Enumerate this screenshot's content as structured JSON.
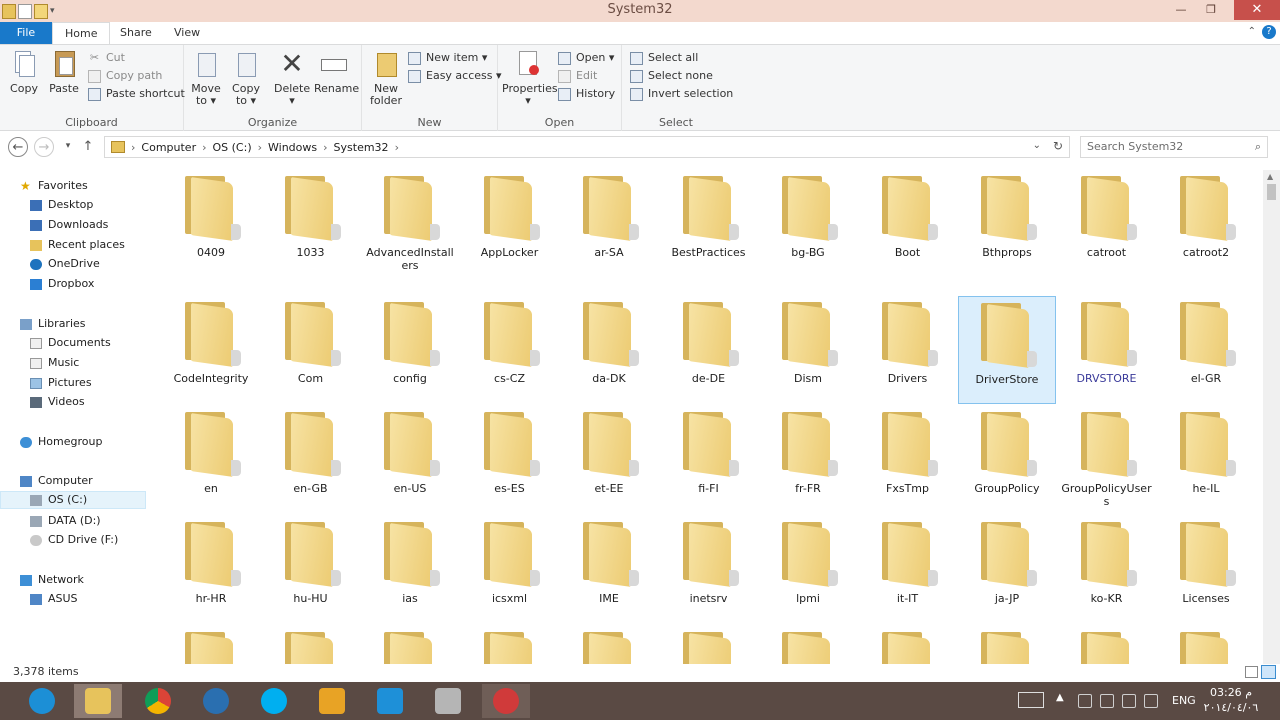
{
  "window": {
    "title": "System32"
  },
  "ribbon_tabs": [
    "File",
    "Home",
    "Share",
    "View"
  ],
  "ribbon": {
    "clipboard": {
      "label": "Clipboard",
      "copy": "Copy",
      "paste": "Paste",
      "cut": "Cut",
      "copy_path": "Copy path",
      "paste_shortcut": "Paste shortcut"
    },
    "organize": {
      "label": "Organize",
      "move_to": "Move",
      "move_to2": "to ▾",
      "copy_to": "Copy",
      "copy_to2": "to ▾",
      "delete": "Delete",
      "delete2": "▾",
      "rename": "Rename"
    },
    "new": {
      "label": "New",
      "new_folder": "New",
      "new_folder2": "folder",
      "new_item": "New item ▾",
      "easy_access": "Easy access ▾"
    },
    "open": {
      "label": "Open",
      "properties": "Properties",
      "properties2": "▾",
      "open": "Open ▾",
      "edit": "Edit",
      "history": "History"
    },
    "select": {
      "label": "Select",
      "select_all": "Select all",
      "select_none": "Select none",
      "invert": "Invert selection"
    }
  },
  "address": {
    "crumbs": [
      "Computer",
      "OS (C:)",
      "Windows",
      "System32"
    ],
    "search_placeholder": "Search System32"
  },
  "nav": {
    "favorites": {
      "label": "Favorites",
      "items": [
        "Desktop",
        "Downloads",
        "Recent places",
        "OneDrive",
        "Dropbox"
      ]
    },
    "libraries": {
      "label": "Libraries",
      "items": [
        "Documents",
        "Music",
        "Pictures",
        "Videos"
      ]
    },
    "homegroup": "Homegroup",
    "computer": {
      "label": "Computer",
      "items": [
        "OS (C:)",
        "DATA (D:)",
        "CD Drive (F:)"
      ]
    },
    "network": {
      "label": "Network",
      "items": [
        "ASUS"
      ]
    }
  },
  "folders": [
    [
      "0409",
      "1033",
      "AdvancedInstallers",
      "AppLocker",
      "ar-SA",
      "BestPractices",
      "bg-BG",
      "Boot",
      "Bthprops",
      "catroot",
      "catroot2"
    ],
    [
      "CodeIntegrity",
      "Com",
      "config",
      "cs-CZ",
      "da-DK",
      "de-DE",
      "Dism",
      "Drivers",
      "DriverStore",
      "DRVSTORE",
      "el-GR"
    ],
    [
      "en",
      "en-GB",
      "en-US",
      "es-ES",
      "et-EE",
      "fi-FI",
      "fr-FR",
      "FxsTmp",
      "GroupPolicy",
      "GroupPolicyUsers",
      "he-IL"
    ],
    [
      "hr-HR",
      "hu-HU",
      "ias",
      "icsxml",
      "IME",
      "inetsrv",
      "lpmi",
      "it-IT",
      "ja-JP",
      "ko-KR",
      "Licenses"
    ]
  ],
  "status": {
    "count": "3,378 items"
  },
  "taskbar": {
    "lang": "ENG",
    "time": "03:26 م",
    "date": "٢٠١٤/٠٤/٠٦"
  },
  "colors": {
    "file_tab": "#1979ca",
    "selection": "#dbeefc",
    "folder": "#eccb72",
    "taskbar": "#5a4a44"
  }
}
